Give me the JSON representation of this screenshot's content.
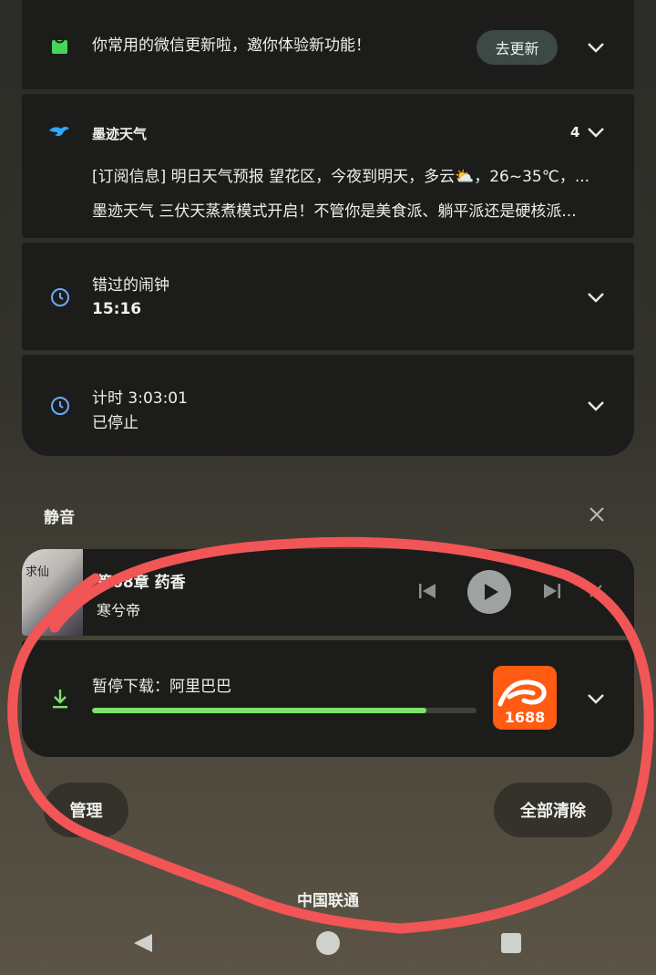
{
  "notifications": {
    "wechat": {
      "text": "你常用的微信更新啦，邀你体验新功能！",
      "button": "去更新",
      "icon": "wechat-update-icon"
    },
    "weather": {
      "app_name": "墨迹天气",
      "count": "4",
      "line1": "[订阅信息] 明日天气预报 望花区，今夜到明天，多云⛅，26~35℃，...",
      "line2": "墨迹天气 三伏天蒸煮模式开启！不管你是美食派、躺平派还是硬核派..."
    },
    "alarm": {
      "title": "错过的闹钟",
      "time": "15:16"
    },
    "timer": {
      "title": "计时 3:03:01",
      "status": "已停止"
    }
  },
  "silent_section": {
    "label": "静音"
  },
  "media": {
    "title": "第68章 药香",
    "artist": "寒兮帝",
    "cover_text": "求仙"
  },
  "download": {
    "title": "暂停下载：阿里巴巴",
    "progress": 0.87,
    "app_logo_text": "1688"
  },
  "actions": {
    "manage": "管理",
    "clear_all": "全部清除"
  },
  "carrier": "中国联通",
  "colors": {
    "accent_green": "#7be56a",
    "card_bg": "#1c1d1a",
    "pill_bg": "#3b4a44",
    "clock_blue": "#69a9ff",
    "weather_blue": "#2ea8ff",
    "logo_orange": "#ff5b12",
    "annotation_red": "#f25555"
  }
}
